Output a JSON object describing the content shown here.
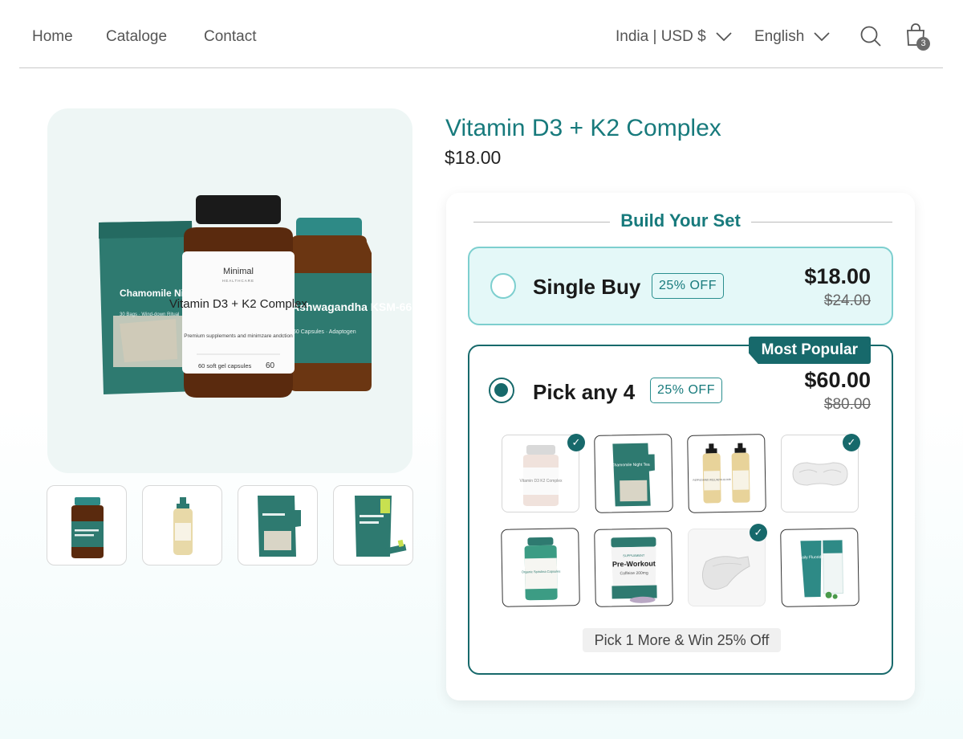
{
  "nav": {
    "links": [
      "Home",
      "Cataloge",
      "Contact"
    ],
    "region": "India | USD $",
    "language": "English",
    "cart_count": "3",
    "icons": {
      "chevron": "chevron-down-icon",
      "search": "search-icon",
      "cart": "shopping-bag-icon"
    }
  },
  "gallery": {
    "hero_labels": {
      "pouch_title": "Chamomile Night Tea",
      "pouch_sub": "30 Bags · Wind-down Ritual",
      "brand": "Minimal",
      "brand_sub": "HEALTHCARE",
      "bottle_title": "Vitamin D3 + K2 Complex",
      "bottle_sub": "Premium supplements and minimzare andction",
      "bottle_count_label": "60 soft gel capsules",
      "bottle_count": "60",
      "jar_title": "Ashwagandha KSM-66",
      "jar_sub": "60 Capsules · Adaptogen"
    },
    "thumbnails": [
      "Magnesium Glycinate",
      "Refreshing Wellness Elixir",
      "Chamomile Night Tea",
      "Electrolyte Hydration Sticks"
    ]
  },
  "product": {
    "title": "Vitamin D3 + K2 Complex",
    "price": "$18.00"
  },
  "bundle": {
    "heading": "Build Your Set",
    "options": [
      {
        "label": "Single Buy",
        "badge": "25% OFF",
        "price": "$18.00",
        "was": "$24.00",
        "selected": false
      },
      {
        "label": "Pick any 4",
        "badge": "25% OFF",
        "price": "$60.00",
        "was": "$80.00",
        "selected": true,
        "ribbon": "Most Popular"
      }
    ],
    "items": [
      {
        "name": "Vitamin D3 K2 Complex",
        "selected": true
      },
      {
        "name": "Chamomile Night Tea",
        "selected": false
      },
      {
        "name": "Refreshing Wellness Elixir",
        "selected": false
      },
      {
        "name": "Silk Sleep Mask",
        "selected": true
      },
      {
        "name": "Organic Spirulina Capsules",
        "selected": false
      },
      {
        "name": "Pre-Workout",
        "selected": false
      },
      {
        "name": "Cotton Socks",
        "selected": true
      },
      {
        "name": "Daily Fluoride Toothpaste",
        "selected": false
      }
    ],
    "item_texts": {
      "jar1": "Vitamin D3 K2 Complex",
      "pouch1": "Chamomile Night Tea",
      "elixir": "REFRESHING WELLNESS ELIXIR",
      "spir": "Organic Spirulina Capsules",
      "preworkout_brand": "SUPPLEMENT",
      "preworkout": "Pre-Workout",
      "preworkout_sub": "Caffeine 200mg",
      "paste": "Daily Fluoride"
    },
    "progress_note": "Pick 1 More & Win 25% Off"
  },
  "colors": {
    "accent": "#177a7c",
    "accent_dark": "#17696b",
    "accent_light": "#e4f8f8"
  }
}
